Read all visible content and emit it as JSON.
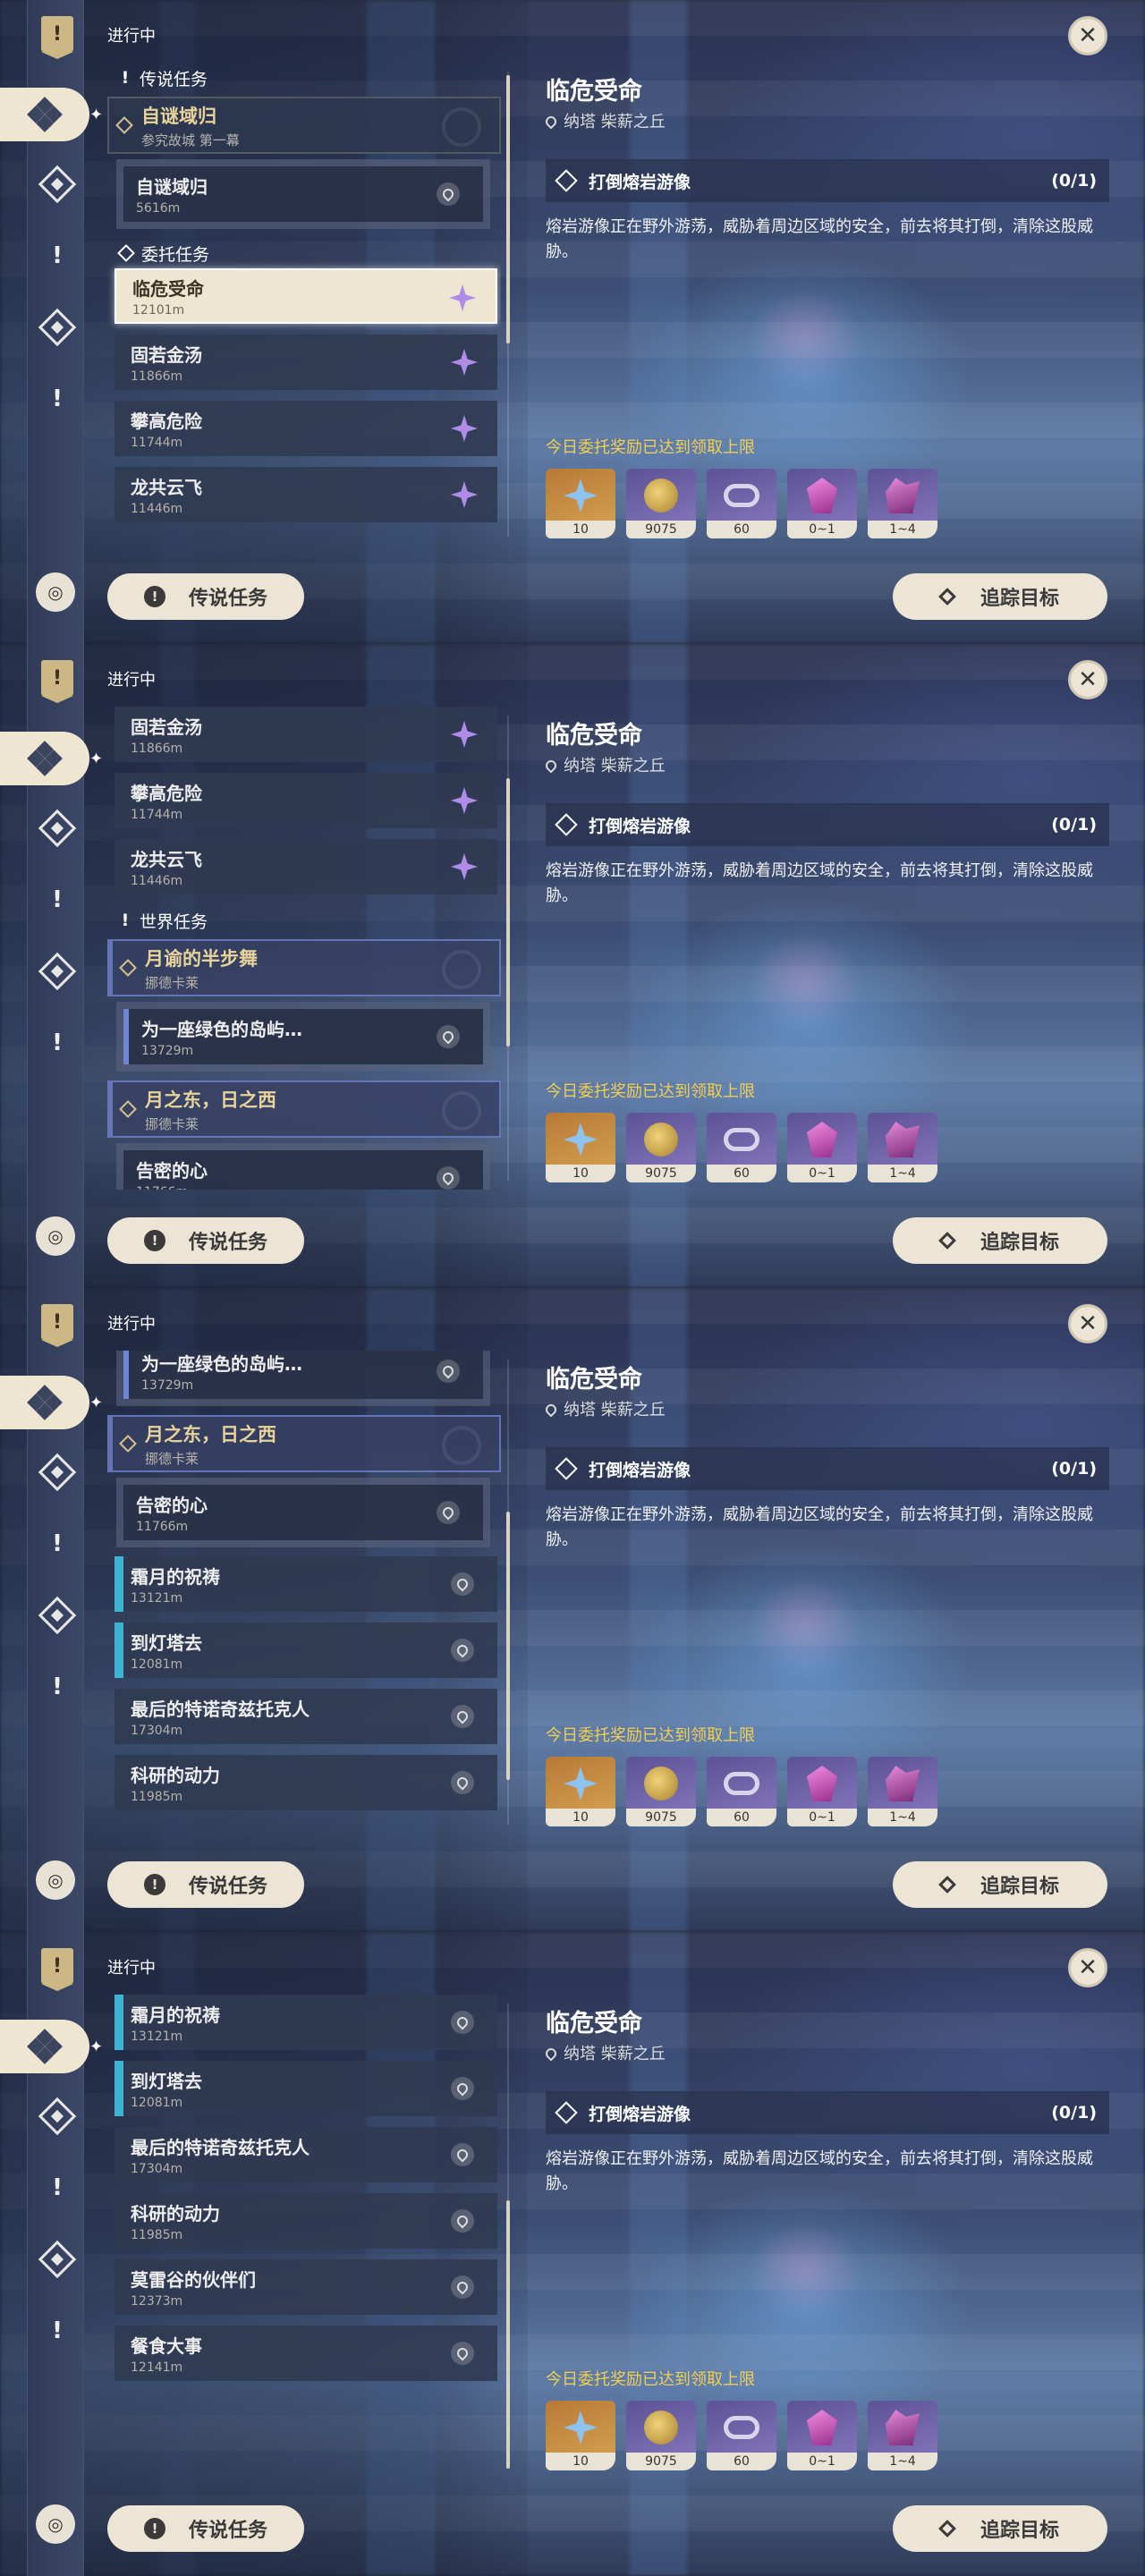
{
  "header": {
    "in_progress": "进行中",
    "close_label": "✕"
  },
  "buttons": {
    "legend": "传说任务",
    "track": "追踪目标"
  },
  "sections": {
    "legend": "传说任务",
    "commission": "委托任务",
    "world": "世界任务"
  },
  "detail": {
    "title": "临危受命",
    "location": "纳塔 柴薪之丘",
    "objective": "打倒熔岩游像",
    "progress": "(0/1)",
    "description": "熔岩游像正在野外游荡，威胁着周边区域的安全，前去将其打倒，清除这股威胁。",
    "reward_notice": "今日委托奖励已达到领取上限",
    "rewards": [
      {
        "icon": "intertwined-fate-star-icon",
        "count": "10"
      },
      {
        "icon": "mora-coin-icon",
        "count": "9075"
      },
      {
        "icon": "companionship-ring-icon",
        "count": "60"
      },
      {
        "icon": "crystal-gem-icon",
        "count": "0~1"
      },
      {
        "icon": "crystal-cluster-icon",
        "count": "1~4"
      }
    ]
  },
  "quests": {
    "zimi": {
      "title": "自谜域归",
      "sub": "参究故城 第一幕",
      "child_title": "自谜域归",
      "child_dist": "5616m"
    },
    "c1": {
      "title": "临危受命",
      "dist": "12101m"
    },
    "c2": {
      "title": "固若金汤",
      "dist": "11866m"
    },
    "c3": {
      "title": "攀高危险",
      "dist": "11744m"
    },
    "c4": {
      "title": "龙共云飞",
      "dist": "11446m"
    },
    "moon": {
      "title": "月谕的半步舞",
      "sub": "挪德卡莱",
      "child_title": "为一座绿色的岛屿…",
      "child_dist": "13729m"
    },
    "sun": {
      "title": "月之东，日之西",
      "sub": "挪德卡莱",
      "child_title": "告密的心",
      "child_dist": "11766m"
    },
    "w1": {
      "title": "霜月的祝祷",
      "dist": "13121m"
    },
    "w2": {
      "title": "到灯塔去",
      "dist": "12081m"
    },
    "w3": {
      "title": "最后的特诺奇兹托克人",
      "dist": "17304m"
    },
    "w4": {
      "title": "科研的动力",
      "dist": "11985m"
    },
    "w5": {
      "title": "莫雷谷的伙伴们",
      "dist": "12373m"
    },
    "w6": {
      "title": "餐食大事",
      "dist": "12141m"
    }
  }
}
